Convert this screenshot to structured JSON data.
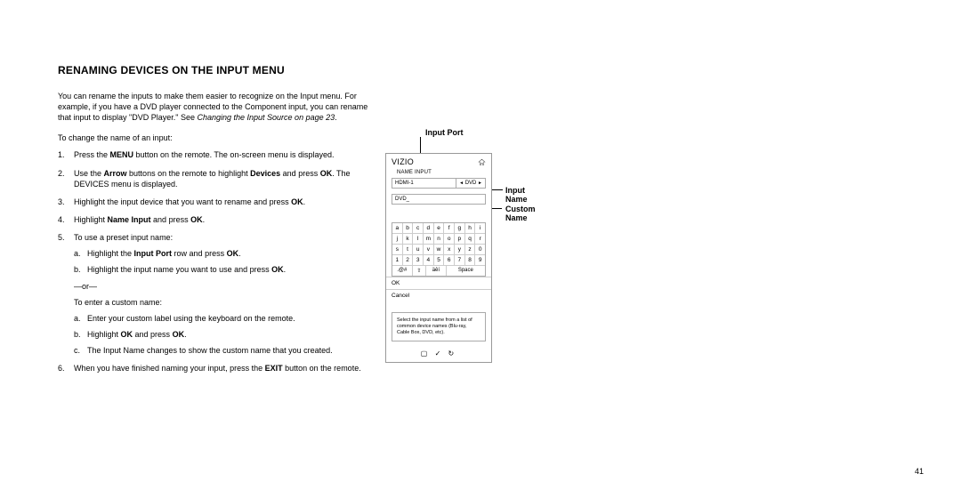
{
  "heading": "RENAMING DEVICES ON THE INPUT MENU",
  "intro": {
    "text1": "You can rename the inputs to make them easier to recognize on the Input menu. For example, if you have a DVD player connected to the Component input, you can rename that input to display \"DVD Player.\" See ",
    "text2": "Changing the Input Source on page 23",
    "text3": "."
  },
  "lead_in": "To change the name of an input:",
  "steps": {
    "s1a": "Press the ",
    "s1b": "MENU",
    "s1c": " button on the remote. The on-screen menu is displayed.",
    "s2a": "Use the ",
    "s2b": "Arrow",
    "s2c": " buttons on the remote to highlight ",
    "s2d": "Devices",
    "s2e": " and press ",
    "s2f": "OK",
    "s2g": ". The DEVICES menu is displayed.",
    "s3a": "Highlight the input device that you want to rename and press ",
    "s3b": "OK",
    "s3c": ".",
    "s4a": "Highlight ",
    "s4b": "Name Input",
    "s4c": " and press ",
    "s4d": "OK",
    "s4e": ".",
    "s5": "To use a preset input name:",
    "s5a1": "Highlight the ",
    "s5a2": "Input Port",
    "s5a3": " row and press ",
    "s5a4": "OK",
    "s5a5": ".",
    "s5b1": "Highlight the input name you want to use and press ",
    "s5b2": "OK",
    "s5b3": ".",
    "or": "—or—",
    "enter_custom": "To enter a custom name:",
    "s5ca": "Enter your custom label using the keyboard on the remote.",
    "s5cb1": "Highlight ",
    "s5cb2": "OK",
    "s5cb3": " and press ",
    "s5cb4": "OK",
    "s5cb5": ".",
    "s5cc": "The Input Name changes to show the custom name that you created.",
    "s6a": "When you have finished naming your input, press the ",
    "s6b": "EXIT",
    "s6c": " button on the remote."
  },
  "callouts": {
    "input_port": "Input Port",
    "input_name": "Input Name",
    "custom_name": "Custom Name"
  },
  "osd": {
    "brand": "VIZIO",
    "title": "NAME INPUT",
    "port": "HDMI-1",
    "input_name": "DVD",
    "custom": "DVD_",
    "kb": {
      "r1": [
        "a",
        "b",
        "c",
        "d",
        "e",
        "f",
        "g",
        "h",
        "i"
      ],
      "r2": [
        "j",
        "k",
        "l",
        "m",
        "n",
        "o",
        "p",
        "q",
        "r"
      ],
      "r3": [
        "s",
        "t",
        "u",
        "v",
        "w",
        "x",
        "y",
        "z",
        "0"
      ],
      "r4": [
        "1",
        "2",
        "3",
        "4",
        "5",
        "6",
        "7",
        "8",
        "9"
      ],
      "r5a": ".@#",
      "r5b": "⇧",
      "r5c": "äêí",
      "r5d": "Space"
    },
    "ok": "OK",
    "cancel": "Cancel",
    "help": "Select the input name from a list of common device names (Blu-ray, Cable Box, DVD, etc).",
    "footer_a": "▢",
    "footer_b": "✓",
    "footer_c": "↻"
  },
  "page_number": "41"
}
